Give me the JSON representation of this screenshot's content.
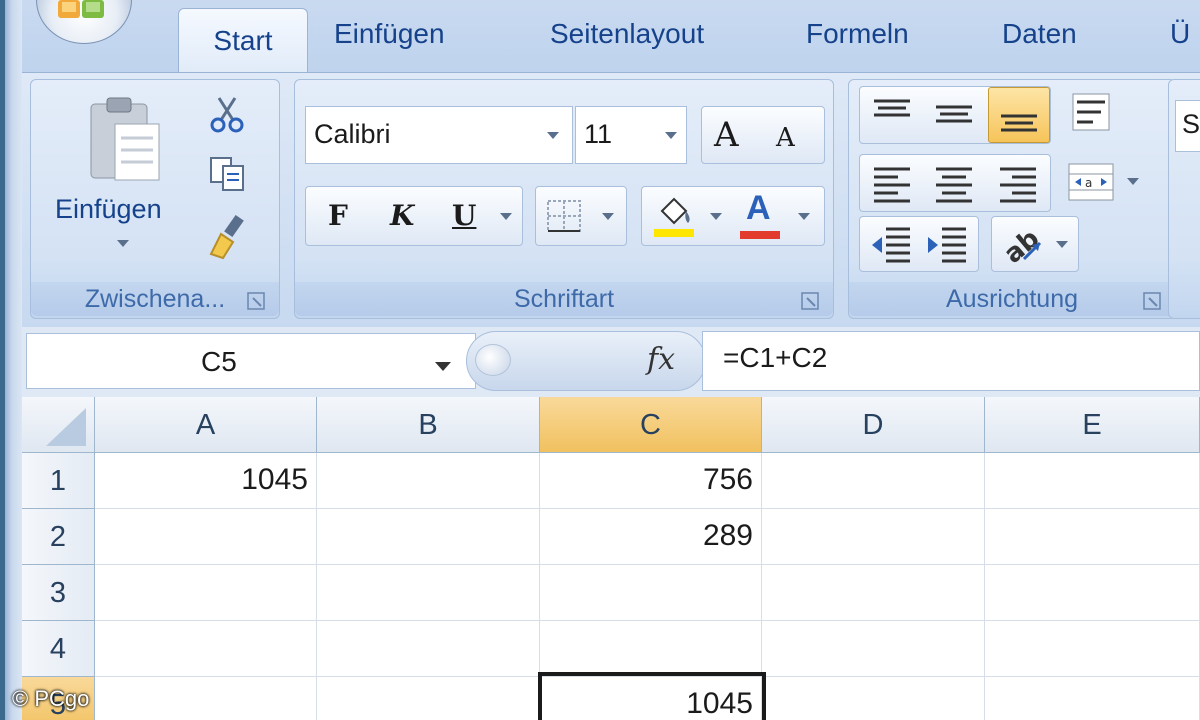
{
  "tabs": [
    "Start",
    "Einfügen",
    "Seitenlayout",
    "Formeln",
    "Daten",
    "Ü"
  ],
  "ribbon": {
    "clipboard": {
      "label": "Zwischena...",
      "paste_label": "Einfügen"
    },
    "font": {
      "label": "Schriftart",
      "font_name": "Calibri",
      "font_size": "11",
      "bold": "F",
      "italic": "K",
      "underline": "U",
      "grow": "A",
      "shrink": "A",
      "font_color_glyph": "A"
    },
    "alignment": {
      "label": "Ausrichtung"
    },
    "styles": {
      "partial_label": "S"
    }
  },
  "formula_bar": {
    "name_box": "C5",
    "fx": "fx",
    "formula": "=C1+C2"
  },
  "sheet": {
    "columns": [
      "A",
      "B",
      "C",
      "D",
      "E"
    ],
    "selected_column": "C",
    "rows": [
      {
        "num": "1",
        "A": "1045",
        "B": "",
        "C": "756",
        "D": "",
        "E": ""
      },
      {
        "num": "2",
        "A": "",
        "B": "",
        "C": "289",
        "D": "",
        "E": ""
      },
      {
        "num": "3",
        "A": "",
        "B": "",
        "C": "",
        "D": "",
        "E": ""
      },
      {
        "num": "4",
        "A": "",
        "B": "",
        "C": "",
        "D": "",
        "E": ""
      },
      {
        "num": "5",
        "A": "",
        "B": "",
        "C": "1045",
        "D": "",
        "E": ""
      }
    ],
    "active_cell": "C5"
  },
  "watermark": "© PCgo",
  "colors": {
    "ribbon": "#dfe9f7",
    "selection": "#f1c15f",
    "text": "#15428b"
  }
}
